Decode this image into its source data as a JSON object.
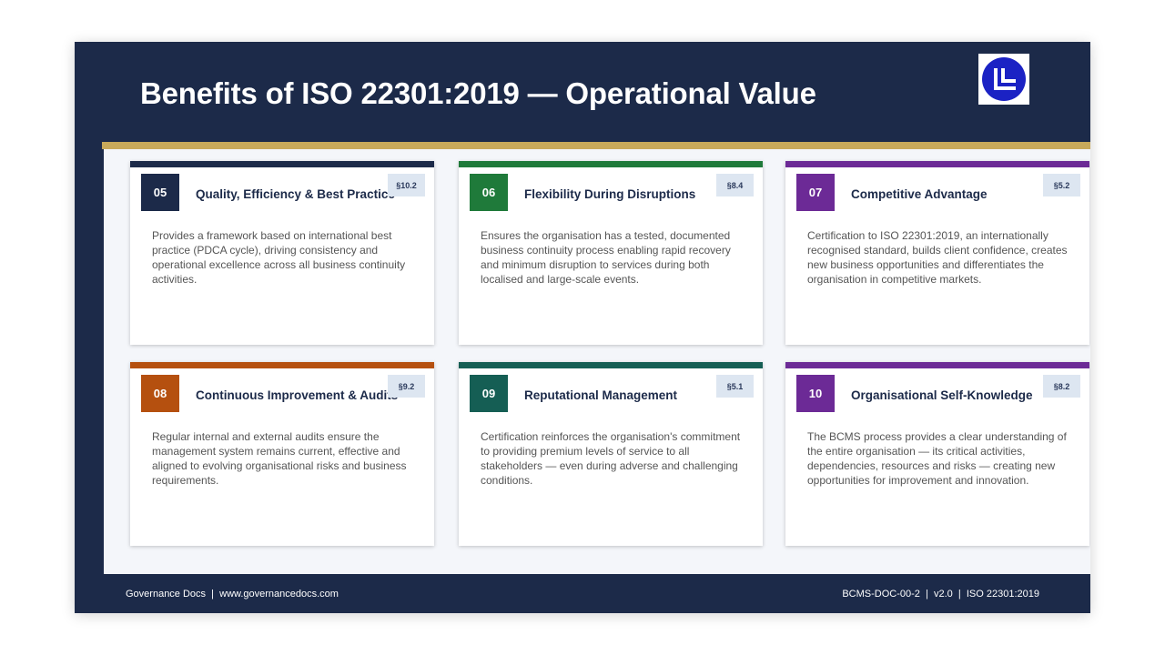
{
  "slide": {
    "title": "Benefits of ISO 22301:2019 — Operational Value",
    "logo": "governance-docs-logo"
  },
  "colors": {
    "navy": "#1c2a49",
    "gold": "#c8a95a",
    "green": "#1f7a3a",
    "purple": "#6c2a96",
    "orange": "#b5500f",
    "teal": "#155e54",
    "ref_badge": "#dde6f1"
  },
  "cards": [
    {
      "number": "05",
      "title": "Quality, Efficiency & Best Practice",
      "ref": "§10.2",
      "description": "Provides a framework based on international best practice (PDCA cycle), driving consistency and operational excellence across all business continuity activities.",
      "color": "#1c2a49"
    },
    {
      "number": "06",
      "title": "Flexibility During Disruptions",
      "ref": "§8.4",
      "description": "Ensures the organisation has a tested, documented business continuity process enabling rapid recovery and minimum disruption to services during both localised and large-scale events.",
      "color": "#1f7a3a"
    },
    {
      "number": "07",
      "title": "Competitive Advantage",
      "ref": "§5.2",
      "description": "Certification to ISO 22301:2019, an internationally recognised standard, builds client confidence, creates new business opportunities and differentiates the organisation in competitive markets.",
      "color": "#6c2a96"
    },
    {
      "number": "08",
      "title": "Continuous Improvement & Audits",
      "ref": "§9.2",
      "description": "Regular internal and external audits ensure the management system remains current, effective and aligned to evolving organisational risks and business requirements.",
      "color": "#b5500f"
    },
    {
      "number": "09",
      "title": "Reputational Management",
      "ref": "§5.1",
      "description": "Certification reinforces the organisation's commitment to providing premium levels of service to all stakeholders — even during adverse and challenging conditions.",
      "color": "#155e54"
    },
    {
      "number": "10",
      "title": "Organisational Self-Knowledge",
      "ref": "§8.2",
      "description": "The BCMS process provides a clear understanding of the entire organisation — its critical activities, dependencies, resources and risks — creating new opportunities for improvement and innovation.",
      "color": "#6c2a96"
    }
  ],
  "footer": {
    "left": "Governance Docs  |  www.governancedocs.com",
    "right": "BCMS-DOC-00-2  |  v2.0  |  ISO 22301:2019"
  }
}
